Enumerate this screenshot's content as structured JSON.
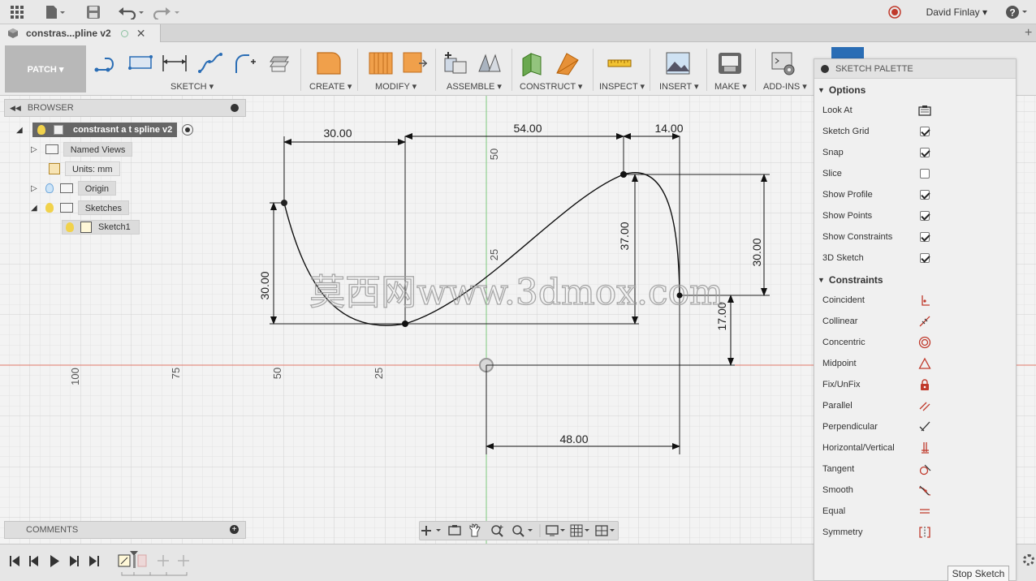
{
  "topbar": {
    "user_name": "David Finlay",
    "user_caret": "▾",
    "help_label": "?"
  },
  "tab": {
    "title": "constras...pline v2"
  },
  "toolbar": {
    "workspace": "PATCH ▾",
    "groups": {
      "sketch": "SKETCH ▾",
      "create": "CREATE ▾",
      "modify": "MODIFY ▾",
      "assemble": "ASSEMBLE ▾",
      "construct": "CONSTRUCT ▾",
      "inspect": "INSPECT ▾",
      "insert": "INSERT ▾",
      "make": "MAKE ▾",
      "addins": "ADD-INS ▾"
    }
  },
  "browser": {
    "title": "BROWSER",
    "root": "constrasnt a t spline v2",
    "items": [
      {
        "label": "Named Views"
      },
      {
        "label": "Units: mm"
      },
      {
        "label": "Origin"
      },
      {
        "label": "Sketches"
      },
      {
        "label": "Sketch1"
      }
    ]
  },
  "comments": {
    "title": "COMMENTS"
  },
  "sketch": {
    "dimensions": [
      "30.00",
      "54.00",
      "14.00",
      "37.00",
      "30.00",
      "30.00",
      "17.00",
      "48.00"
    ],
    "axis_labels_vertical": [
      "50",
      "25"
    ],
    "axis_labels_horizontal": [
      "100",
      "75",
      "50",
      "25"
    ],
    "watermark": "莫西网www.3dmox.com"
  },
  "palette": {
    "title": "SKETCH PALETTE",
    "options_title": "Options",
    "options": [
      {
        "label": "Look At",
        "icon": "look-at-icon"
      },
      {
        "label": "Sketch Grid",
        "checked": true
      },
      {
        "label": "Snap",
        "checked": true
      },
      {
        "label": "Slice",
        "checked": false
      },
      {
        "label": "Show Profile",
        "checked": true
      },
      {
        "label": "Show Points",
        "checked": true
      },
      {
        "label": "Show Constraints",
        "checked": true
      },
      {
        "label": "3D Sketch",
        "checked": true
      }
    ],
    "constraints_title": "Constraints",
    "constraints": [
      {
        "label": "Coincident",
        "icon": "coincident-icon"
      },
      {
        "label": "Collinear",
        "icon": "collinear-icon"
      },
      {
        "label": "Concentric",
        "icon": "concentric-icon"
      },
      {
        "label": "Midpoint",
        "icon": "midpoint-icon"
      },
      {
        "label": "Fix/UnFix",
        "icon": "lock-icon"
      },
      {
        "label": "Parallel",
        "icon": "parallel-icon"
      },
      {
        "label": "Perpendicular",
        "icon": "perpendicular-icon"
      },
      {
        "label": "Horizontal/Vertical",
        "icon": "horizontal-vertical-icon"
      },
      {
        "label": "Tangent",
        "icon": "tangent-icon"
      },
      {
        "label": "Smooth",
        "icon": "smooth-icon"
      },
      {
        "label": "Equal",
        "icon": "equal-icon"
      },
      {
        "label": "Symmetry",
        "icon": "symmetry-icon"
      }
    ],
    "stop_button": "Stop Sketch"
  },
  "colors": {
    "accent": "#2a6db5",
    "axis_x": "#e2786a",
    "axis_y": "#7ec97e",
    "constraint_red": "#c0392b"
  }
}
